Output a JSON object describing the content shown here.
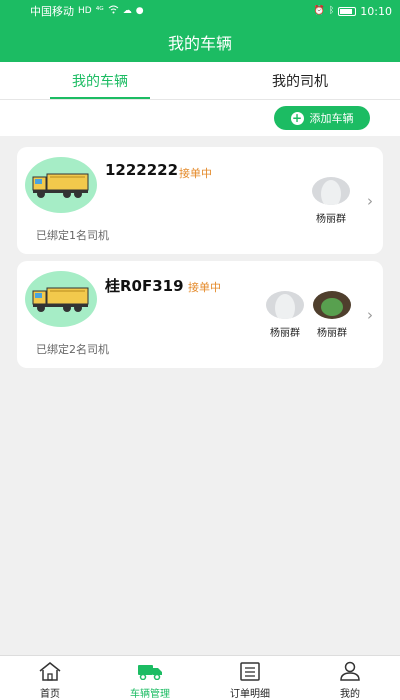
{
  "status_bar": {
    "carrier": "中国移动",
    "network": "HD",
    "signal": "⁴ᴳ",
    "time": "10:10"
  },
  "header": {
    "title": "我的车辆"
  },
  "tabs": [
    {
      "label": "我的车辆",
      "active": true
    },
    {
      "label": "我的司机",
      "active": false
    }
  ],
  "add_button": {
    "label": "添加车辆"
  },
  "vehicles": [
    {
      "plate": "1222222",
      "status": "接单中",
      "bound_text": "已绑定1名司机",
      "drivers": [
        {
          "name": "杨丽群"
        }
      ]
    },
    {
      "plate": "桂R0F319",
      "status": "接单中",
      "bound_text": "已绑定2名司机",
      "drivers": [
        {
          "name": "杨丽群"
        },
        {
          "name": "杨丽群"
        }
      ]
    }
  ],
  "nav": [
    {
      "label": "首页",
      "icon": "home-icon"
    },
    {
      "label": "车辆管理",
      "icon": "truck-icon",
      "active": true
    },
    {
      "label": "订单明细",
      "icon": "order-list-icon"
    },
    {
      "label": "我的",
      "icon": "person-icon"
    }
  ],
  "colors": {
    "accent": "#1cbc63",
    "status": "#e48a2a"
  }
}
